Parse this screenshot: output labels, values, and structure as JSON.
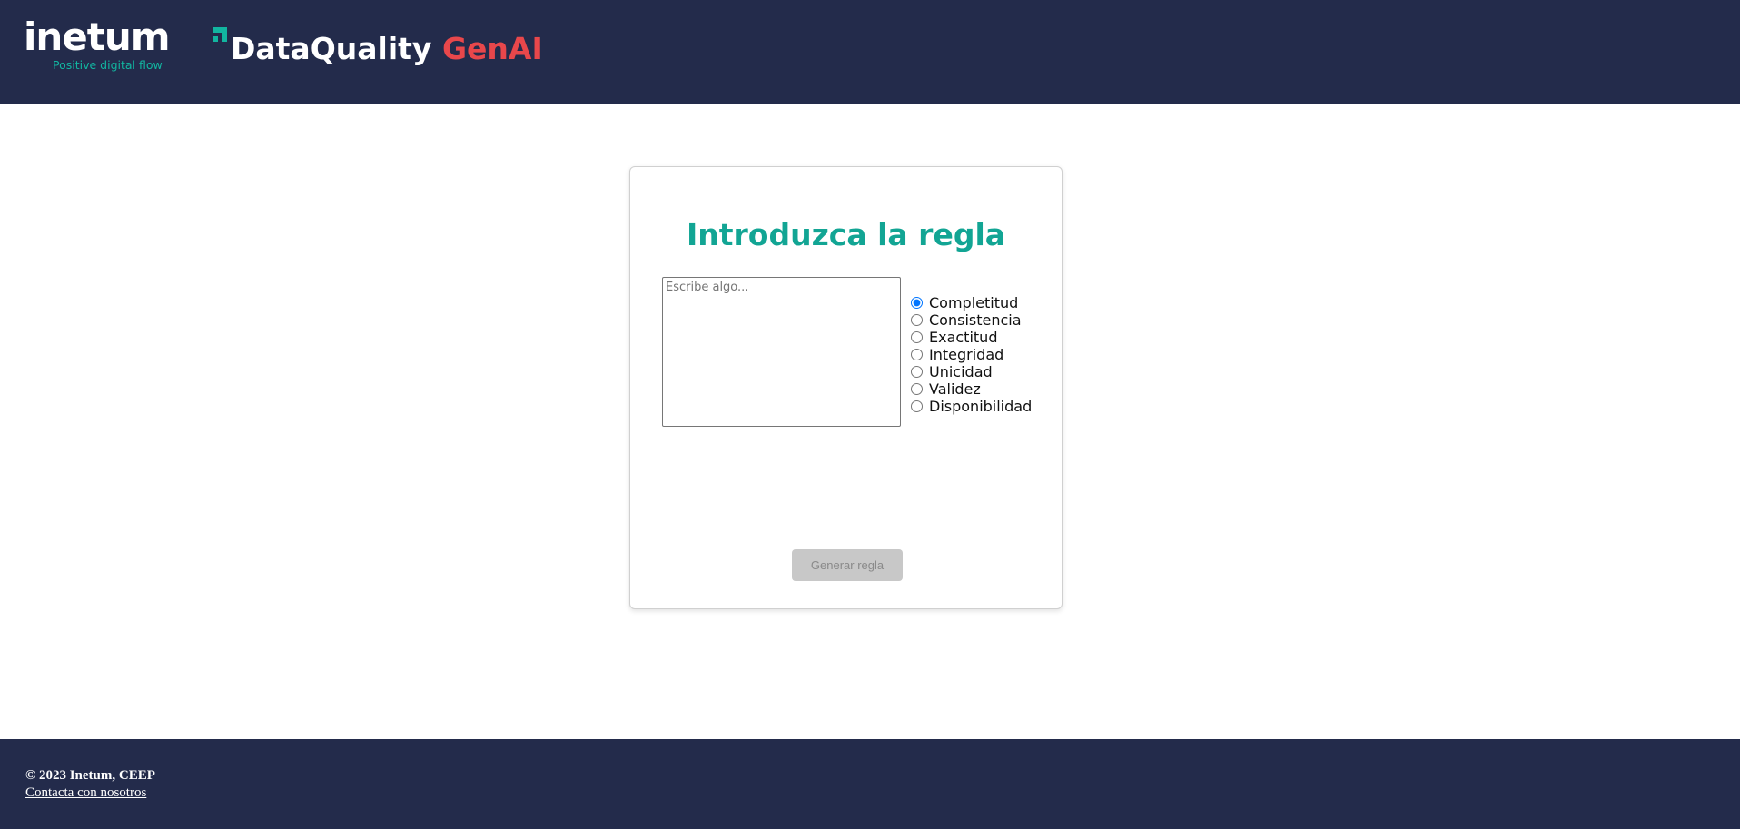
{
  "header": {
    "logo": {
      "wordmark": "inetum",
      "tagline": "Positive digital flow",
      "mark_icon": "inetum-corner-mark-icon",
      "mark_color": "#12b5a0"
    },
    "title_main": "DataQuality",
    "title_accent": "GenAI",
    "background_color": "#232b4b",
    "accent_color": "#e8474b"
  },
  "card": {
    "title": "Introduzca la regla",
    "title_color": "#12a594",
    "input": {
      "value": "",
      "placeholder": "Escribe algo..."
    },
    "radio_options": [
      {
        "label": "Completitud",
        "checked": true
      },
      {
        "label": "Consistencia",
        "checked": false
      },
      {
        "label": "Exactitud",
        "checked": false
      },
      {
        "label": "Integridad",
        "checked": false
      },
      {
        "label": "Unicidad",
        "checked": false
      },
      {
        "label": "Validez",
        "checked": false
      },
      {
        "label": "Disponibilidad",
        "checked": false
      }
    ],
    "generate_button_label": "Generar regla",
    "generate_button_disabled": true
  },
  "footer": {
    "copyright": "© 2023 Inetum, CEEP",
    "contact_link": "Contacta con nosotros"
  }
}
